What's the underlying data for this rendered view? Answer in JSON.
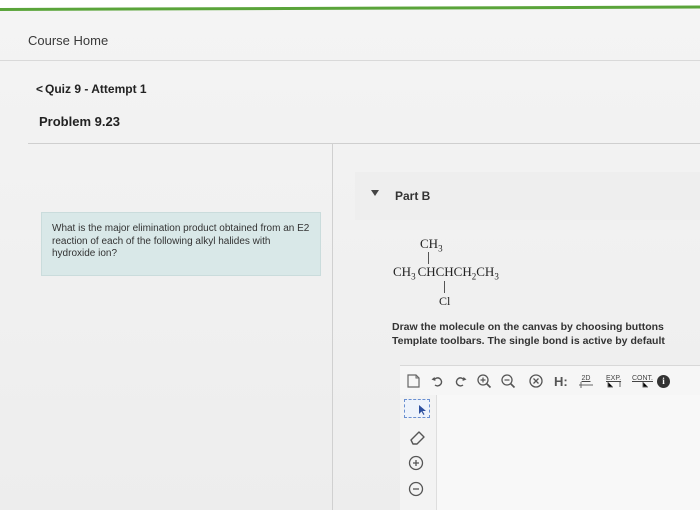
{
  "header": {
    "course_home": "Course Home",
    "back_label": "Quiz 9 - Attempt 1",
    "problem_title": "Problem 9.23"
  },
  "question": {
    "text": "What is the major elimination product obtained from an E2 reaction of each of the following alkyl halides with hydroxide ion?"
  },
  "part": {
    "label": "Part B"
  },
  "molecule": {
    "top_group": "CH",
    "top_sub": "3",
    "chain_prefix": "CH",
    "chain_prefix_sub": "3",
    "chain_mid": "CHCHCH",
    "chain_mid_sub": "2",
    "chain_end": "CH",
    "chain_end_sub": "3",
    "bottom_group": "Cl"
  },
  "instructions": {
    "line1": "Draw the molecule on the canvas by choosing buttons",
    "line2": "Template toolbars. The single bond is active by default"
  },
  "toolbar": {
    "h_label": "H:",
    "label_2d": "2D",
    "label_exp": "EXP.",
    "label_cont": "CONT.",
    "info": "i"
  }
}
